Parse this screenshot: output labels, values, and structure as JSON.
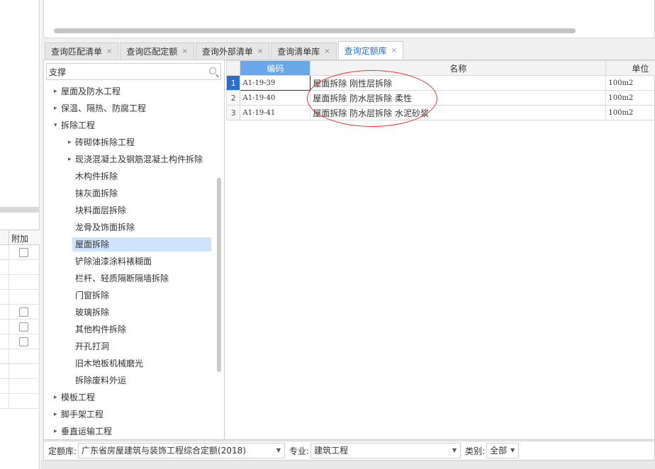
{
  "left_panel": {
    "column_header": "附加"
  },
  "tabs": [
    {
      "label": "查询匹配清单",
      "active": false
    },
    {
      "label": "查询匹配定额",
      "active": false
    },
    {
      "label": "查询外部清单",
      "active": false
    },
    {
      "label": "查询清单库",
      "active": false
    },
    {
      "label": "查询定额库",
      "active": true
    }
  ],
  "tab_close_glyph": "×",
  "search": {
    "value": "支撑"
  },
  "tree": [
    {
      "label": "屋面及防水工程",
      "level": 1,
      "expander": "▸"
    },
    {
      "label": "保温、隔热、防腐工程",
      "level": 1,
      "expander": "▸"
    },
    {
      "label": "拆除工程",
      "level": 1,
      "expander": "▾"
    },
    {
      "label": "砖砌体拆除工程",
      "level": 2,
      "expander": "▸"
    },
    {
      "label": "现浇混凝土及钢筋混凝土构件拆除",
      "level": 2,
      "expander": "▸"
    },
    {
      "label": "木构件拆除",
      "level": 2,
      "expander": ""
    },
    {
      "label": "抹灰面拆除",
      "level": 2,
      "expander": ""
    },
    {
      "label": "块料面层拆除",
      "level": 2,
      "expander": ""
    },
    {
      "label": "龙骨及饰面拆除",
      "level": 2,
      "expander": ""
    },
    {
      "label": "屋面拆除",
      "level": 2,
      "expander": "",
      "selected": true
    },
    {
      "label": "铲除油漆涂料裱糊面",
      "level": 2,
      "expander": ""
    },
    {
      "label": "栏杆、轻质隔断隔墙拆除",
      "level": 2,
      "expander": ""
    },
    {
      "label": "门窗拆除",
      "level": 2,
      "expander": ""
    },
    {
      "label": "玻璃拆除",
      "level": 2,
      "expander": ""
    },
    {
      "label": "其他构件拆除",
      "level": 2,
      "expander": ""
    },
    {
      "label": "开孔打洞",
      "level": 2,
      "expander": ""
    },
    {
      "label": "旧木地板机械磨光",
      "level": 2,
      "expander": ""
    },
    {
      "label": "拆除废料外运",
      "level": 2,
      "expander": ""
    },
    {
      "label": "模板工程",
      "level": 1,
      "expander": "▸"
    },
    {
      "label": "脚手架工程",
      "level": 1,
      "expander": "▸"
    },
    {
      "label": "垂直运输工程",
      "level": 1,
      "expander": "▸"
    }
  ],
  "grid": {
    "columns": {
      "code": "编码",
      "name": "名称",
      "unit": "单位"
    },
    "rows": [
      {
        "n": "1",
        "code": "A1-19-39",
        "name": "屋面拆除 刚性层拆除",
        "unit": "100m2"
      },
      {
        "n": "2",
        "code": "A1-19-40",
        "name": "屋面拆除 防水层拆除 柔性",
        "unit": "100m2"
      },
      {
        "n": "3",
        "code": "A1-19-41",
        "name": "屋面拆除 防水层拆除 水泥砂浆",
        "unit": "100m2"
      }
    ]
  },
  "filter_bar": {
    "quota_label": "定额库:",
    "quota_value": "广东省房屋建筑与装饰工程综合定额(2018)",
    "major_label": "专业:",
    "major_value": "建筑工程",
    "category_label": "类别:",
    "category_value": "全部"
  },
  "colors": {
    "accent": "#2a6fc9",
    "selection": "#cfe3fa",
    "annotation": "#e33333"
  }
}
